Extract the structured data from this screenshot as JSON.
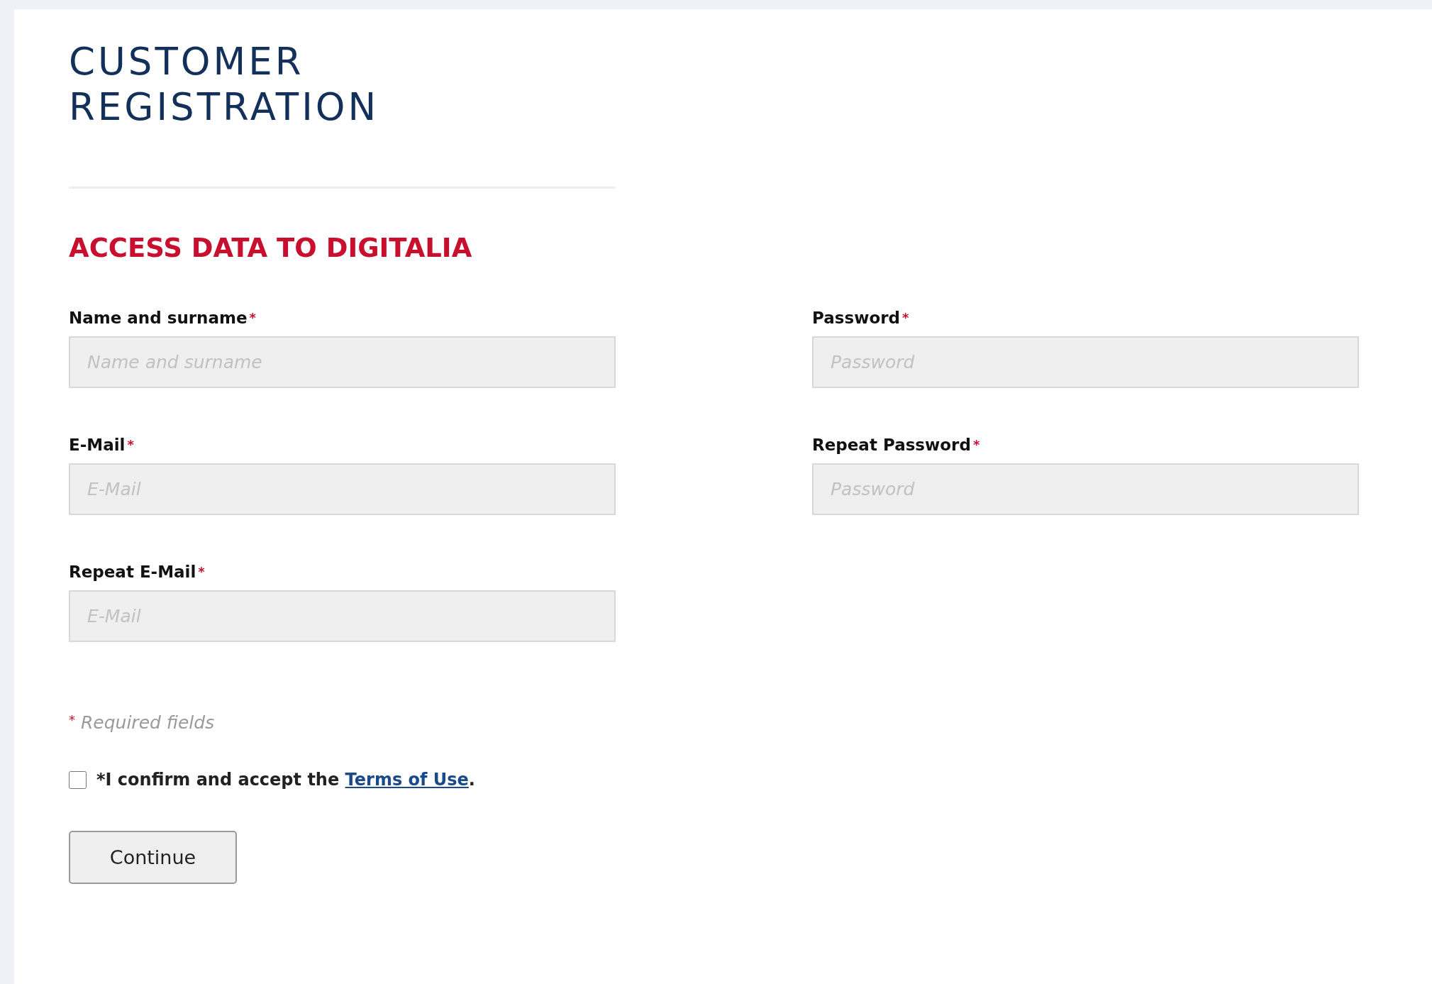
{
  "title": [
    "CUSTOMER",
    "REGISTRATION"
  ],
  "section_heading": "ACCESS DATA TO DIGITALIA",
  "columns": [
    {
      "fields": [
        {
          "label": "Name and surname",
          "required_mark": "*",
          "placeholder": "Name and surname"
        },
        {
          "label": "E-Mail",
          "required_mark": "*",
          "placeholder": "E-Mail"
        },
        {
          "label": "Repeat E-Mail",
          "required_mark": "*",
          "placeholder": "E-Mail"
        }
      ]
    },
    {
      "fields": [
        {
          "label": "Password",
          "required_mark": "*",
          "placeholder": "Password"
        },
        {
          "label": "Repeat Password",
          "required_mark": "*",
          "placeholder": "Password"
        }
      ]
    }
  ],
  "required_note": {
    "mark": "*",
    "text": "Required fields"
  },
  "terms": {
    "checked": false,
    "text_before": "*I confirm and accept the ",
    "link": "Terms of Use",
    "text_after": "."
  },
  "button": "Continue"
}
